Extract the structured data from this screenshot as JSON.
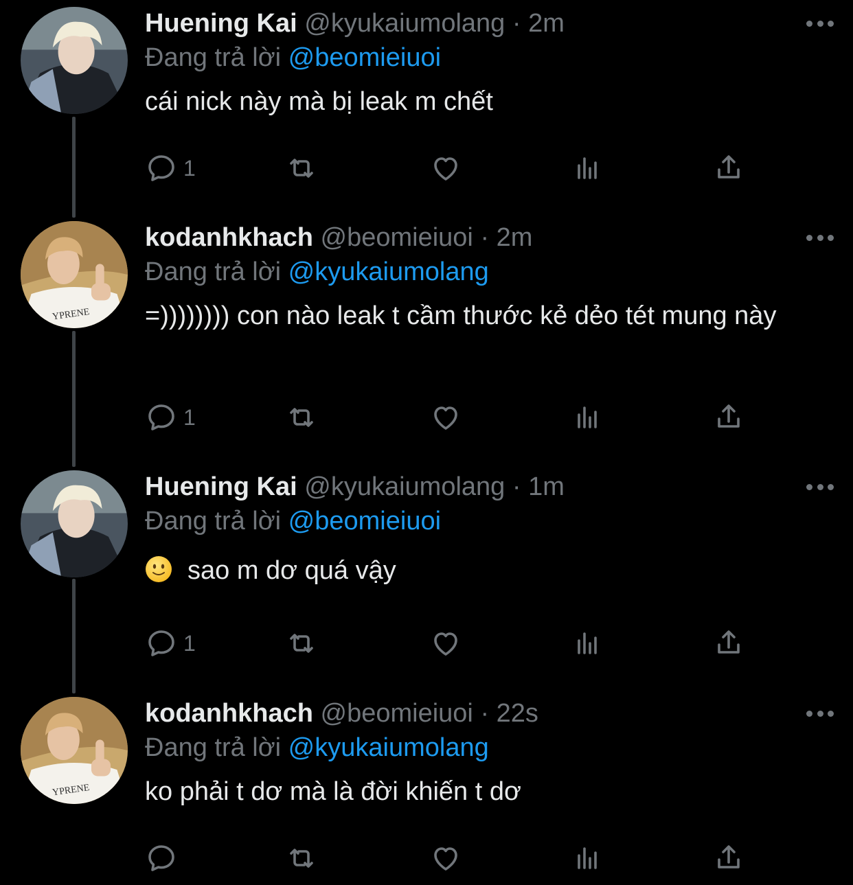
{
  "tweets": [
    {
      "name": "Huening Kai",
      "handle": "@kyukaiumolang",
      "dot": "·",
      "time": "2m",
      "reply_prefix": "Đang trả lời",
      "reply_to": "@beomieiuoi",
      "text": "cái nick này mà bị leak m chết",
      "reply_count": "1"
    },
    {
      "name": "kodanhkhach",
      "handle": "@beomieiuoi",
      "dot": "·",
      "time": "2m",
      "reply_prefix": "Đang trả lời",
      "reply_to": "@kyukaiumolang",
      "text": "=)))))))) con nào leak t cầm thước kẻ dẻo tét mung này",
      "reply_count": "1"
    },
    {
      "name": "Huening Kai",
      "handle": "@kyukaiumolang",
      "dot": "·",
      "time": "1m",
      "reply_prefix": "Đang trả lời",
      "reply_to": "@beomieiuoi",
      "text": "sao m dơ quá vậy",
      "reply_count": "1"
    },
    {
      "name": "kodanhkhach",
      "handle": "@beomieiuoi",
      "dot": "·",
      "time": "22s",
      "reply_prefix": "Đang trả lời",
      "reply_to": "@kyukaiumolang",
      "text": "ko phải t dơ mà là đời khiến t dơ",
      "reply_count": ""
    }
  ],
  "colors": {
    "background": "#000000",
    "text": "#e7e9ea",
    "secondary": "#71767b",
    "mention": "#1d9bf0",
    "thread_line": "#3f4448"
  },
  "icons": [
    "reply-icon",
    "retweet-icon",
    "like-icon",
    "analytics-icon",
    "share-icon",
    "more-icon",
    "slightly-smiling-face-emoji"
  ]
}
